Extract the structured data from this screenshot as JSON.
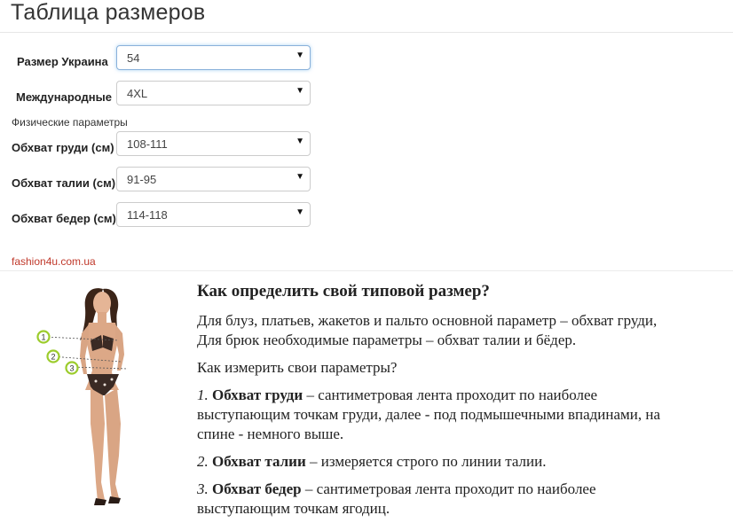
{
  "title": "Таблица размеров",
  "fields": [
    {
      "label": "Размер Украина",
      "value": "54"
    },
    {
      "label": "Международные",
      "value": "4XL"
    }
  ],
  "physical_label": "Физические параметры",
  "physical_fields": [
    {
      "label": "Обхват груди (см)",
      "value": "108-111"
    },
    {
      "label": "Обхват талии (см)",
      "value": "91-95"
    },
    {
      "label": "Обхват бедер (см)",
      "value": "114-118"
    }
  ],
  "site": "fashion4u.com.ua",
  "figure_markers": [
    "1",
    "2",
    "3"
  ],
  "guide": {
    "heading": "Как определить свой типовой размер?",
    "intro_1": "Для блуз, платьев, жакетов и пальто основной параметр – обхват груди,",
    "intro_2": "Для брюк необходимые параметры – обхват талии и бёдер.",
    "how": "Как измерить свои параметры?",
    "items": [
      {
        "num": "1.",
        "term": "Обхват груди",
        "line1": " – сантиметровая лента проходит по наиболее",
        "line2": "выступающим точкам груди, далее - под подмышечными впадинами, на",
        "line3": "спине - немного выше."
      },
      {
        "num": "2.",
        "term": "Обхват талии",
        "line1": " – измеряется строго по линии талии."
      },
      {
        "num": "3.",
        "term": "Обхват бедер",
        "line1": " – сантиметровая лента проходит по наиболее",
        "line2": "выступающим точкам ягодиц."
      }
    ]
  },
  "colors": {
    "site": "#c0392b",
    "marker": "#9ccc2c",
    "focus": "#66afe9"
  }
}
